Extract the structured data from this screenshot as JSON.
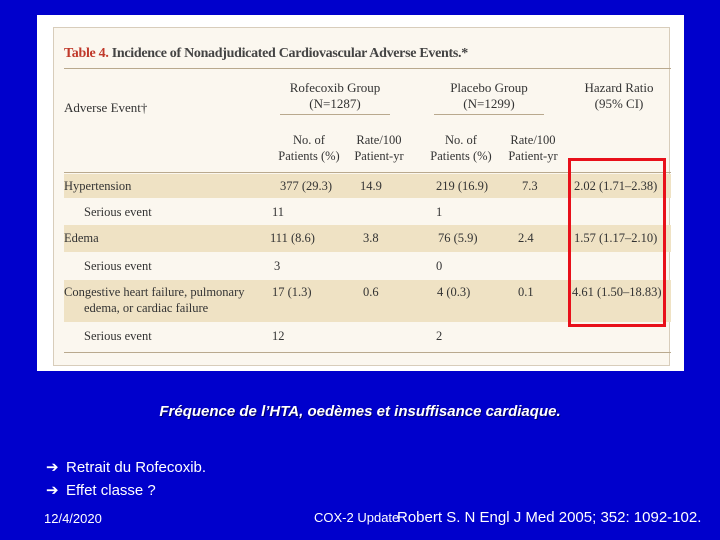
{
  "table": {
    "title_num": "Table 4.",
    "title_text": "Incidence of Nonadjudicated Cardiovascular Adverse Events.*",
    "group_rofecoxib": "Rofecoxib Group",
    "group_rofecoxib_n": "(N=1287)",
    "group_placebo": "Placebo Group",
    "group_placebo_n": "(N=1299)",
    "hazard_ratio": "Hazard Ratio",
    "hazard_ci": "(95% CI)",
    "adverse_event": "Adverse Event†",
    "sub_no_of": "No. of",
    "sub_patients_pct": "Patients (%)",
    "sub_rate100": "Rate/100",
    "sub_patient_yr": "Patient-yr",
    "rows": [
      {
        "label": "Hypertension",
        "label2": "",
        "rofe_n": "377 (29.3)",
        "rofe_rate": "14.9",
        "plac_n": "219 (16.9)",
        "plac_rate": "7.3",
        "hr": "2.02 (1.71–2.38)"
      },
      {
        "label": "Serious event",
        "label2": "",
        "rofe_n": "11",
        "rofe_rate": "",
        "plac_n": "1",
        "plac_rate": "",
        "hr": ""
      },
      {
        "label": "Edema",
        "label2": "",
        "rofe_n": "111 (8.6)",
        "rofe_rate": "3.8",
        "plac_n": "76 (5.9)",
        "plac_rate": "2.4",
        "hr": "1.57 (1.17–2.10)"
      },
      {
        "label": "Serious event",
        "label2": "",
        "rofe_n": "3",
        "rofe_rate": "",
        "plac_n": "0",
        "plac_rate": "",
        "hr": ""
      },
      {
        "label": "Congestive heart failure, pulmonary",
        "label2": "edema, or cardiac failure",
        "rofe_n": "17 (1.3)",
        "rofe_rate": "0.6",
        "plac_n": "4 (0.3)",
        "plac_rate": "0.1",
        "hr": "4.61 (1.50–18.83)"
      },
      {
        "label": "Serious event",
        "label2": "",
        "rofe_n": "12",
        "rofe_rate": "",
        "plac_n": "2",
        "plac_rate": "",
        "hr": ""
      }
    ]
  },
  "caption": "Fréquence de l’HTA, oedèmes et insuffisance cardiaque.",
  "bullets": [
    "Retrait du Rofecoxib.",
    "Effet classe ?"
  ],
  "footer": {
    "date": "12/4/2020",
    "slide_title": "COX-2 Update",
    "reference": "Robert S. N Engl J Med 2005; 352: 1092-102."
  },
  "colors": {
    "background": "#0000cc",
    "highlight_box": "#e8101a",
    "row_shade": "#efe2c4",
    "title_number": "#c0392b"
  }
}
